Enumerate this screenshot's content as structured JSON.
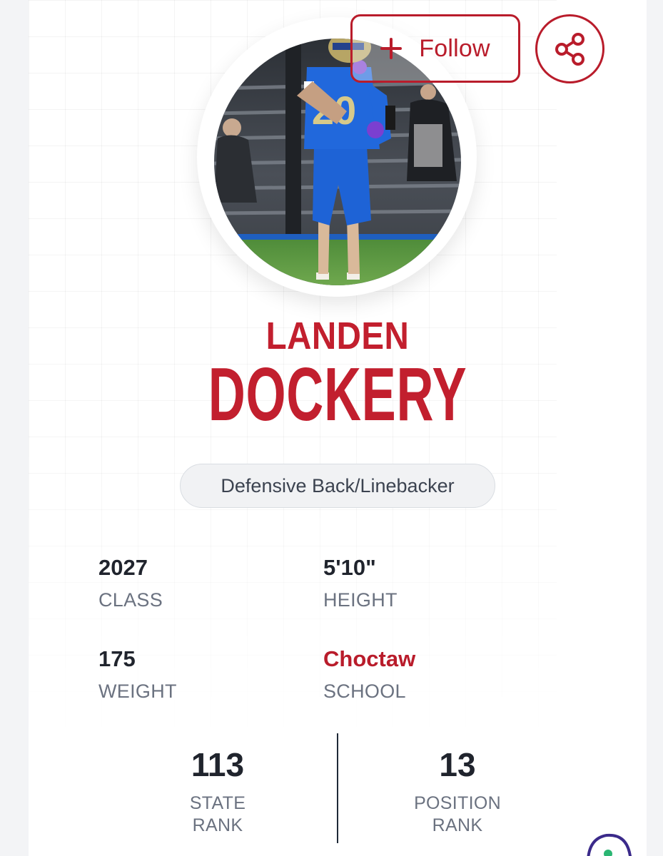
{
  "actions": {
    "follow_label": "Follow"
  },
  "player": {
    "first_name": "LANDEN",
    "last_name": "DOCKERY",
    "position": "Defensive Back/Linebacker",
    "jersey_number": "20"
  },
  "stats": [
    {
      "value": "2027",
      "label": "CLASS",
      "highlight": false
    },
    {
      "value": "5'10\"",
      "label": "HEIGHT",
      "highlight": false
    },
    {
      "value": "175",
      "label": "WEIGHT",
      "highlight": false
    },
    {
      "value": "Choctaw",
      "label": "SCHOOL",
      "highlight": true
    }
  ],
  "rankings": [
    {
      "value": "113",
      "label_line1": "STATE",
      "label_line2": "RANK"
    },
    {
      "value": "13",
      "label_line1": "POSITION",
      "label_line2": "RANK"
    }
  ],
  "colors": {
    "brand_red": "#c21f2e",
    "text_dark": "#20242d",
    "text_muted": "#6b7280"
  }
}
